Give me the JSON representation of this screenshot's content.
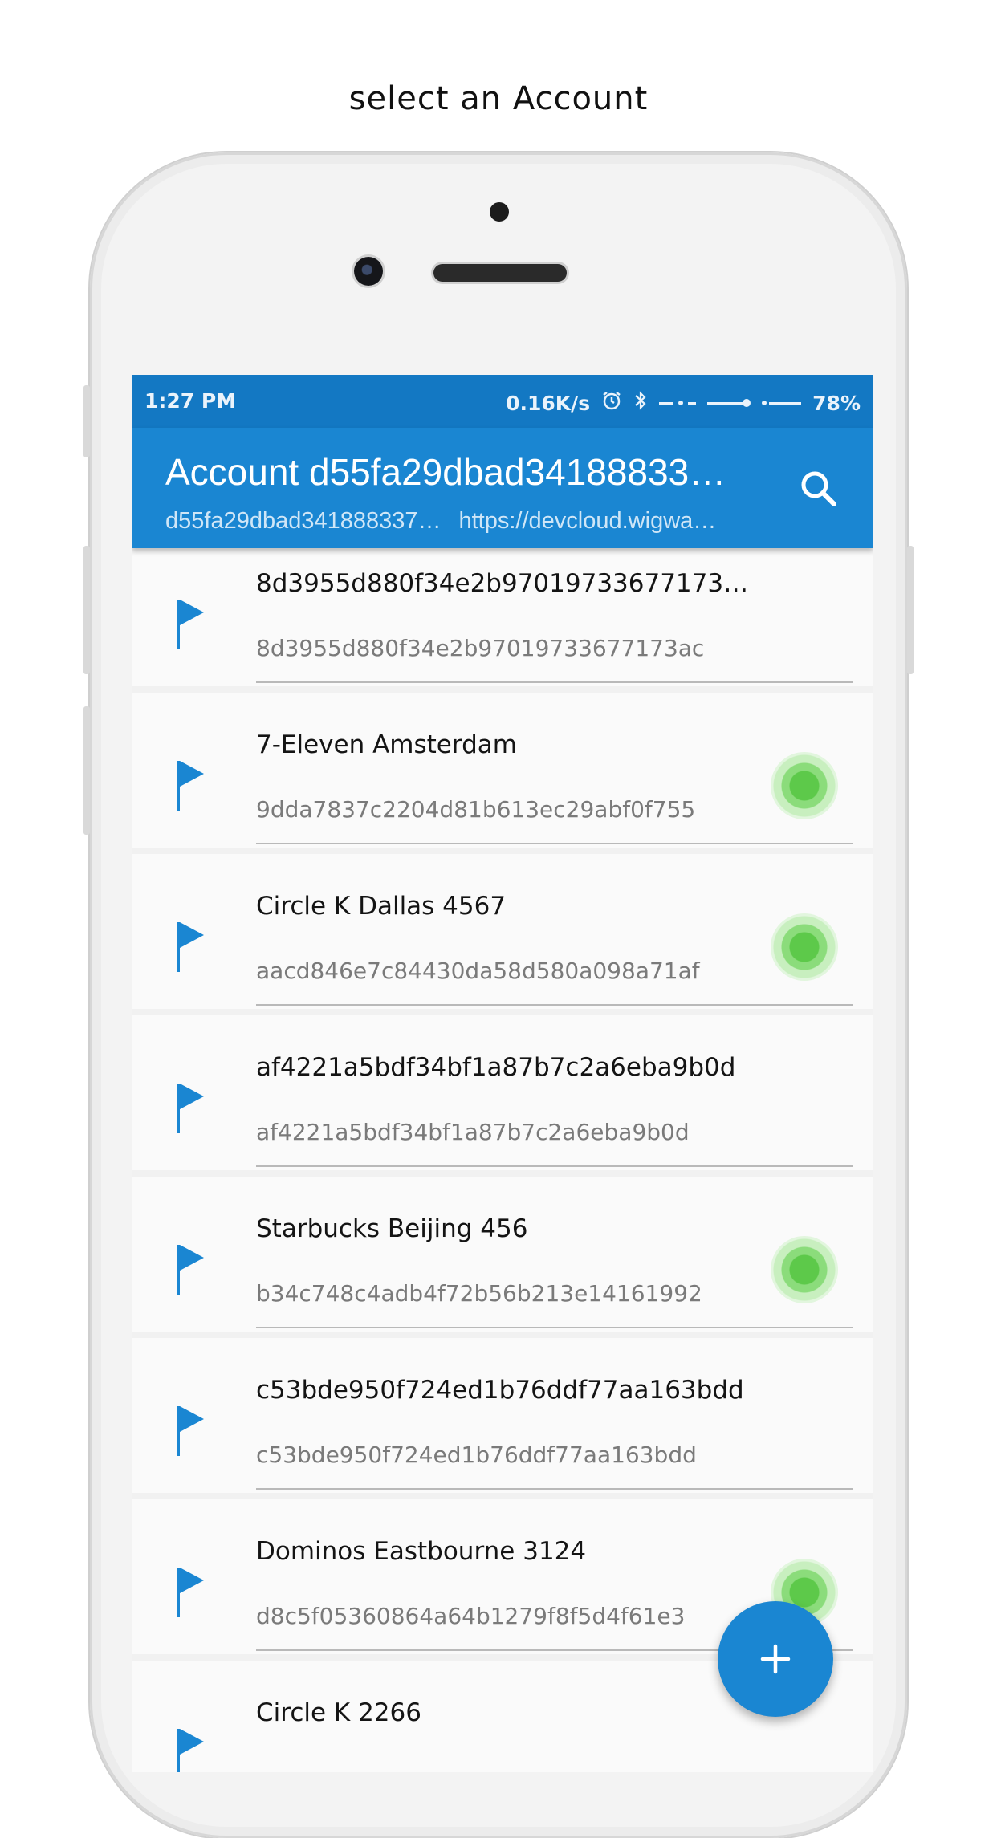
{
  "caption": "select an Account",
  "status_bar": {
    "time": "1:27 PM",
    "network_speed": "0.16K/s",
    "battery": "78%",
    "icons": [
      "alarm-icon",
      "bluetooth-icon",
      "signal-icon",
      "wifi-icon"
    ]
  },
  "app_bar": {
    "title": "Account d55fa29dbad34188833…",
    "subtitle_id": "d55fa29dbad341888337…",
    "subtitle_url": "https://devcloud.wigwa…",
    "search_icon": "search-icon"
  },
  "accounts": [
    {
      "name": "8d3955d880f34e2b97019733677173…",
      "id": "8d3955d880f34e2b97019733677173ac",
      "online": false
    },
    {
      "name": "7-Eleven Amsterdam",
      "id": "9dda7837c2204d81b613ec29abf0f755",
      "online": true
    },
    {
      "name": "Circle K Dallas 4567",
      "id": "aacd846e7c84430da58d580a098a71af",
      "online": true
    },
    {
      "name": "af4221a5bdf34bf1a87b7c2a6eba9b0d",
      "id": "af4221a5bdf34bf1a87b7c2a6eba9b0d",
      "online": false
    },
    {
      "name": "Starbucks Beijing 456",
      "id": "b34c748c4adb4f72b56b213e14161992",
      "online": true
    },
    {
      "name": "c53bde950f724ed1b76ddf77aa163bdd",
      "id": "c53bde950f724ed1b76ddf77aa163bdd",
      "online": false
    },
    {
      "name": "Dominos Eastbourne 3124",
      "id": "d8c5f05360864a64b1279f8f5d4f61e3",
      "online": true
    },
    {
      "name": "Circle K 2266",
      "id": "",
      "online": false
    }
  ],
  "colors": {
    "status_bar": "#1378c3",
    "app_bar": "#1a86d2",
    "flag": "#1a86d2",
    "online": "#5dc94a"
  },
  "fab": {
    "icon": "plus-icon"
  }
}
